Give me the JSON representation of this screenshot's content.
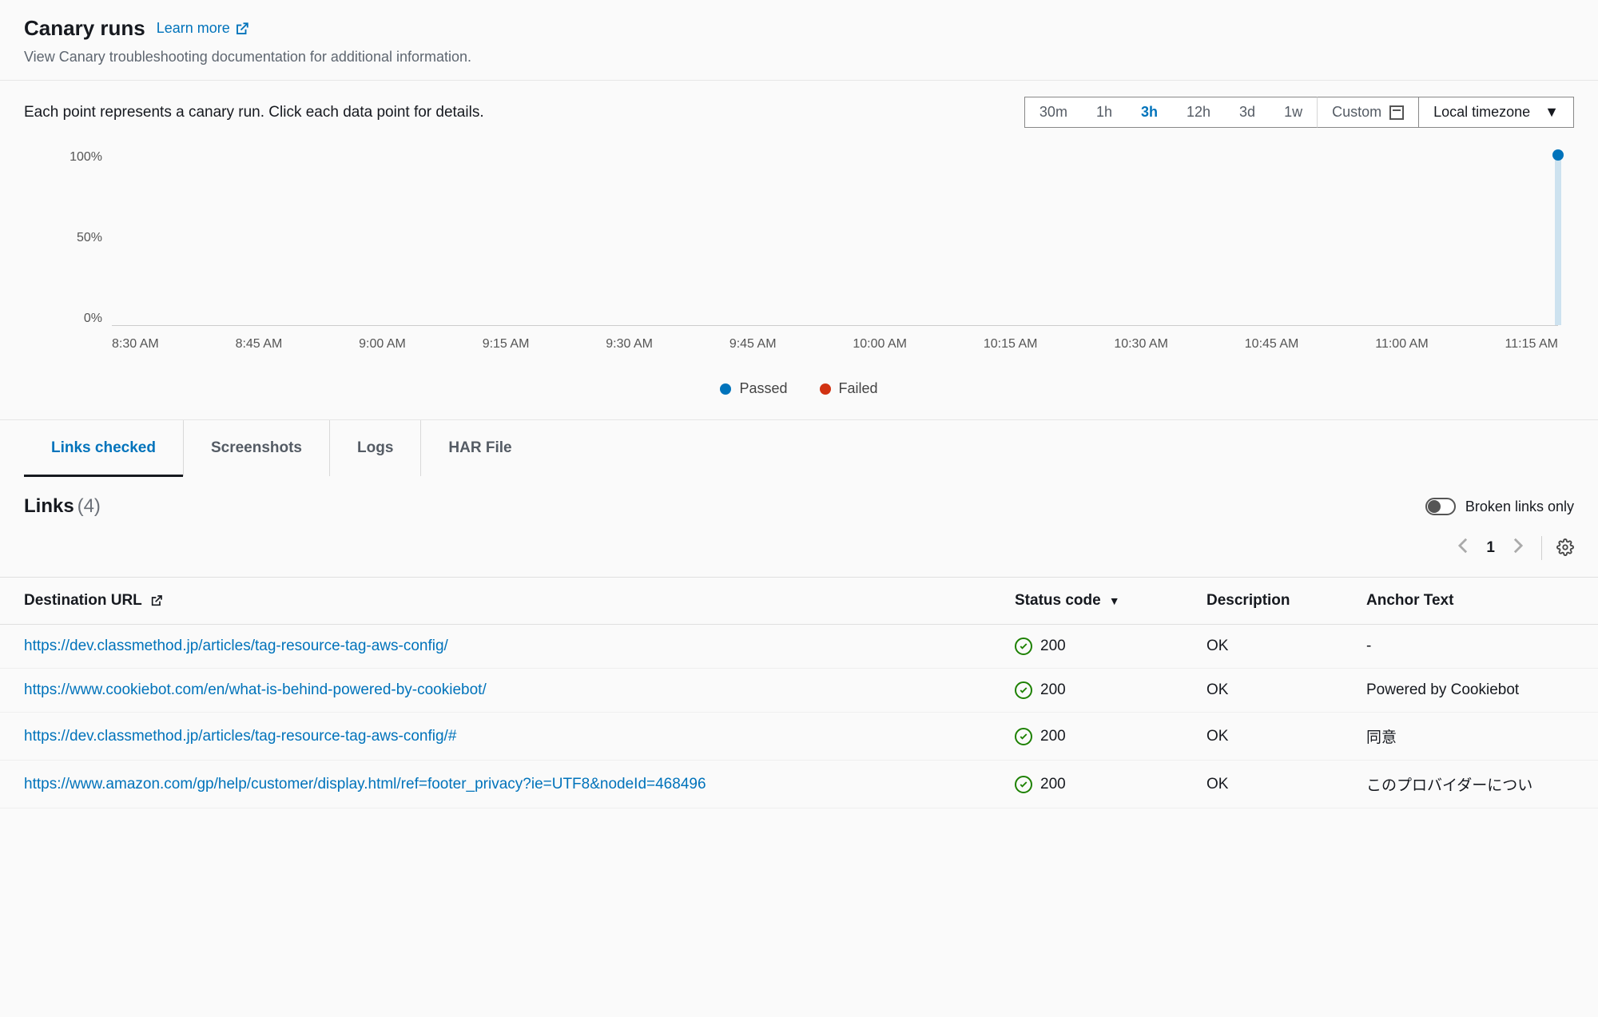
{
  "header": {
    "title": "Canary runs",
    "learn_more": "Learn more",
    "subtitle": "View Canary troubleshooting documentation for additional information."
  },
  "chart": {
    "hint": "Each point represents a canary run. Click each data point for details.",
    "time_ranges": [
      "30m",
      "1h",
      "3h",
      "12h",
      "3d",
      "1w"
    ],
    "active_range": "3h",
    "custom_label": "Custom",
    "timezone_label": "Local timezone",
    "legend": {
      "passed": "Passed",
      "failed": "Failed"
    },
    "colors": {
      "passed": "#0073bb",
      "failed": "#d13212"
    }
  },
  "chart_data": {
    "type": "scatter",
    "title": "",
    "xlabel": "",
    "ylabel": "",
    "ylim": [
      0,
      100
    ],
    "y_ticks": [
      "100%",
      "50%",
      "0%"
    ],
    "x_ticks": [
      "8:30 AM",
      "8:45 AM",
      "9:00 AM",
      "9:15 AM",
      "9:30 AM",
      "9:45 AM",
      "10:00 AM",
      "10:15 AM",
      "10:30 AM",
      "10:45 AM",
      "11:00 AM",
      "11:15 AM"
    ],
    "series": [
      {
        "name": "Passed",
        "color": "#0073bb",
        "points": [
          {
            "x": "11:15 AM",
            "y": 100
          }
        ]
      },
      {
        "name": "Failed",
        "color": "#d13212",
        "points": []
      }
    ]
  },
  "tabs": {
    "items": [
      "Links checked",
      "Screenshots",
      "Logs",
      "HAR File"
    ],
    "active": "Links checked"
  },
  "links_panel": {
    "title": "Links",
    "count": "(4)",
    "toggle_label": "Broken links only",
    "page": "1"
  },
  "table": {
    "columns": {
      "url": "Destination URL",
      "status": "Status code",
      "desc": "Description",
      "anchor": "Anchor Text"
    },
    "rows": [
      {
        "url": "https://dev.classmethod.jp/articles/tag-resource-tag-aws-config/",
        "status": "200",
        "desc": "OK",
        "anchor": "-"
      },
      {
        "url": "https://www.cookiebot.com/en/what-is-behind-powered-by-cookiebot/",
        "status": "200",
        "desc": "OK",
        "anchor": "Powered by Cookiebot"
      },
      {
        "url": "https://dev.classmethod.jp/articles/tag-resource-tag-aws-config/#",
        "status": "200",
        "desc": "OK",
        "anchor": "同意"
      },
      {
        "url": "https://www.amazon.com/gp/help/customer/display.html/ref=footer_privacy?ie=UTF8&nodeId=468496",
        "status": "200",
        "desc": "OK",
        "anchor": "このプロバイダーについ"
      }
    ]
  }
}
